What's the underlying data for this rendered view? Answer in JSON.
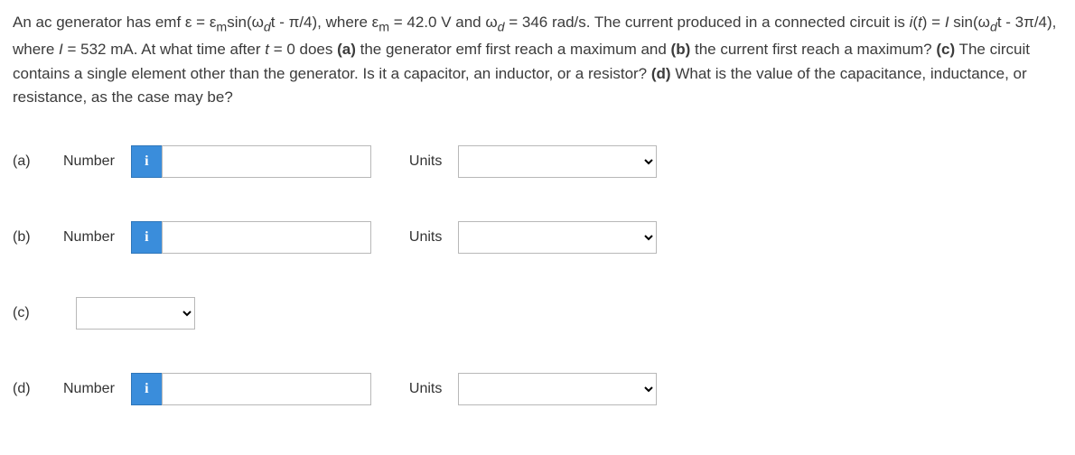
{
  "question": {
    "text": "An ac generator has emf ε = εₘsin(ω_d t - π/4), where εₘ = 42.0 V and ω_d = 346 rad/s. The current produced in a connected circuit is i(t) = I sin(ω_d t - 3π/4), where I = 532 mA. At what time after t = 0 does (a) the generator emf first reach a maximum and (b) the current first reach a maximum? (c) The circuit contains a single element other than the generator. Is it a capacitor, an inductor, or a resistor? (d) What is the value of the capacitance, inductance, or resistance, as the case may be?"
  },
  "labels": {
    "number": "Number",
    "units": "Units",
    "info": "i"
  },
  "parts": {
    "a": "(a)",
    "b": "(b)",
    "c": "(c)",
    "d": "(d)"
  }
}
